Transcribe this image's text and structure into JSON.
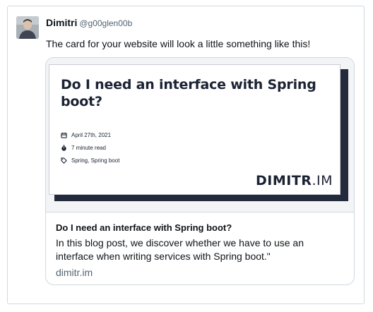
{
  "tweet": {
    "author": {
      "name": "Dimitri",
      "handle": "@g00glen00b"
    },
    "text": "The card for your website will look a little something like this!"
  },
  "card": {
    "image": {
      "title": "Do I need an interface with Spring boot?",
      "date": "April 27th, 2021",
      "read_time": "7 minute read",
      "tags": "Spring, Spring boot",
      "brand_bold": "DIMITR",
      "brand_rest": ".IM",
      "icons": [
        "calendar-icon",
        "stopwatch-icon",
        "tag-icon"
      ]
    },
    "title": "Do I need an interface with Spring boot?",
    "description": "In this blog post, we discover whether we have to use an interface when writing services with Spring boot.\"",
    "domain": "dimitr.im"
  }
}
